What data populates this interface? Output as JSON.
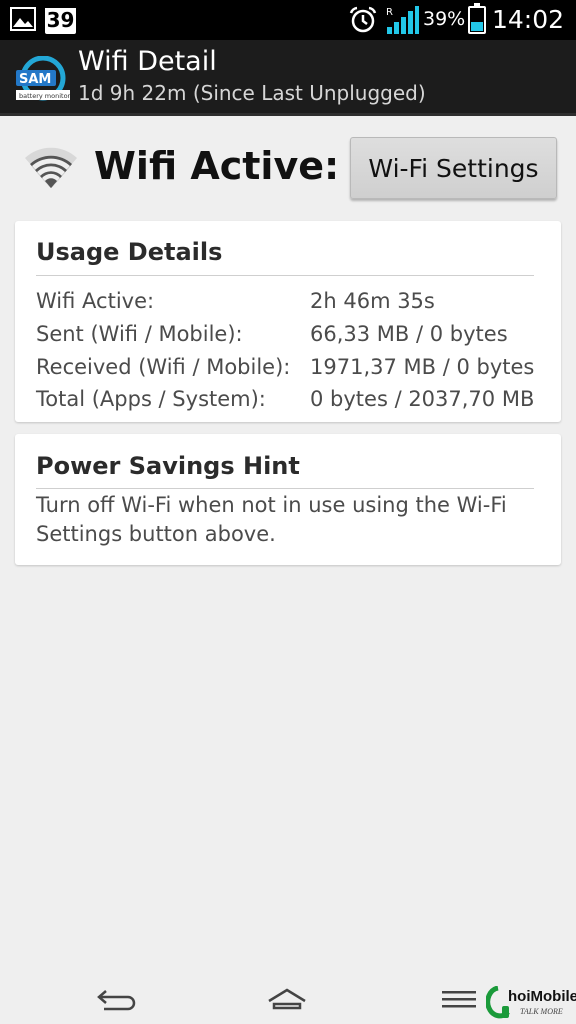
{
  "status_bar": {
    "image_icon": "image-icon",
    "calendar_day": "39",
    "alarm_icon": "alarm-icon",
    "roaming_indicator": "R",
    "battery_percent": "39%",
    "battery_level": 0.39,
    "battery_color": "#22c7e8",
    "time": "14:02"
  },
  "action_bar": {
    "logo_text": "SAM",
    "logo_subtext": "battery monitor",
    "title": "Wifi Detail",
    "subtitle": "1d 9h 22m (Since Last Unplugged)"
  },
  "wifi": {
    "icon": "wifi-icon",
    "title": "Wifi Active:",
    "settings_button_label": "Wi-Fi Settings"
  },
  "usage": {
    "title": "Usage Details",
    "rows": [
      {
        "label": "Wifi Active:",
        "value": "2h 46m 35s"
      },
      {
        "label": "Sent (Wifi / Mobile):",
        "value": "66,33 MB / 0 bytes"
      },
      {
        "label": "Received (Wifi / Mobile):",
        "value": "1971,37 MB / 0 bytes"
      },
      {
        "label": "Total (Apps / System):",
        "value": "0 bytes / 2037,70 MB"
      }
    ]
  },
  "hint": {
    "title": "Power Savings Hint",
    "text": "Turn off Wi-Fi when not in use using the Wi-Fi Settings button above."
  },
  "navigation": {
    "back_icon": "back-icon",
    "home_icon": "home-icon",
    "menu_icon": "menu-icon"
  },
  "watermark": {
    "text": "hoiMobile",
    "slogan": "TALK MORE"
  }
}
